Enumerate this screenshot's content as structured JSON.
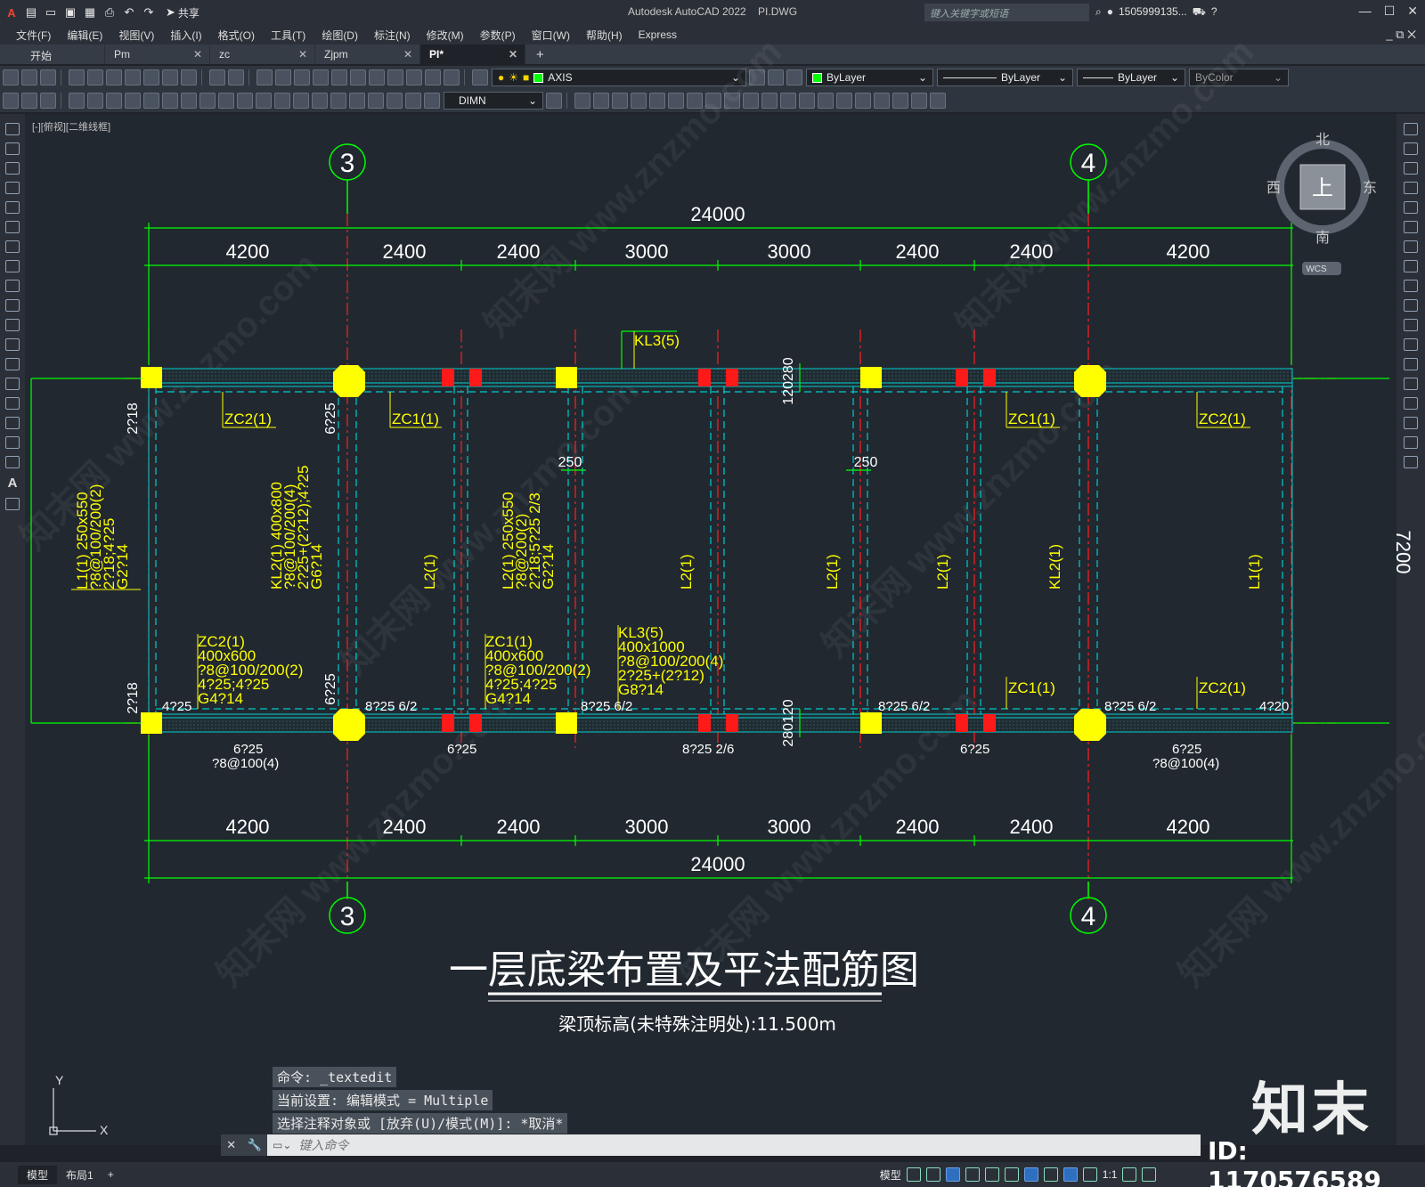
{
  "app": {
    "title": "Autodesk AutoCAD 2022",
    "filename": "PI.DWG",
    "search_placeholder": "键入关键字或短语",
    "user": "1505999135...",
    "share_label": "共享"
  },
  "menu": [
    "文件(F)",
    "编辑(E)",
    "视图(V)",
    "插入(I)",
    "格式(O)",
    "工具(T)",
    "绘图(D)",
    "标注(N)",
    "修改(M)",
    "参数(P)",
    "窗口(W)",
    "帮助(H)",
    "Express"
  ],
  "tabs": [
    "开始",
    "Pm",
    "zc",
    "Zjpm",
    "PI*"
  ],
  "toolbar": {
    "layer": "AXIS",
    "color": "ByLayer",
    "linetype": "ByLayer",
    "lineweight": "ByLayer",
    "plotstyle": "ByColor",
    "dimstyle": "DIMN"
  },
  "viewport": {
    "label": "[-][俯视][二维线框]",
    "viewcube": {
      "top": "上",
      "n": "北",
      "s": "南",
      "e": "东",
      "w": "西",
      "wcs": "WCS"
    }
  },
  "colors": {
    "axis": "#00ff00",
    "dim_text": "#ffffff",
    "beam_text": "#ffff00",
    "beam_line": "#00cccc",
    "column": "#ffff00",
    "axis_line": "#ff0000"
  },
  "drawing": {
    "axis_top_left": "3",
    "axis_top_right": "4",
    "axis_bottom_left": "3",
    "axis_bottom_right": "4",
    "total_top": "24000",
    "total_bottom": "24000",
    "spans_top": [
      "4200",
      "2400",
      "2400",
      "3000",
      "3000",
      "2400",
      "2400",
      "4200"
    ],
    "spans_bottom": [
      "4200",
      "2400",
      "2400",
      "3000",
      "3000",
      "2400",
      "2400",
      "4200"
    ],
    "right_dim": "7200",
    "labels": {
      "kl3_top": "KL3(5)",
      "zc2_tl": "ZC2(1)",
      "zc1_t1": "ZC1(1)",
      "zc1_t2": "ZC1(1)",
      "zc2_tr": "ZC2(1)",
      "zc1_b": "ZC1(1)",
      "zc2_br": "ZC2(1)",
      "d250a": "250",
      "d250b": "250",
      "d120_280": "120280",
      "d280_120": "280120",
      "d625a": "6?25",
      "d625b": "6?25",
      "d218a": "2?18",
      "d218b": "2?18",
      "l1_left": [
        "L1(1) 250x550",
        "?8@100/200(2)",
        "2?18;4?25",
        "G2?14"
      ],
      "kl2_mid": [
        "KL2(1) 400x800",
        "?8@100/200(4)",
        "2?25+(2?12);4?25",
        "G6?14"
      ],
      "l2_col": [
        "L2(1) 250x550",
        "?8@200(2)",
        "2?18;5?25 2/3",
        "G2?14"
      ],
      "l2a": "L2(1)",
      "l2b": "L2(1)",
      "l2c": "L2(1)",
      "l2d": "L2(1)",
      "kl2_r": "KL2(1)",
      "l1_r": "L1(1)",
      "zc2_block": [
        "ZC2(1)",
        "400x600",
        "?8@100/200(2)",
        "4?25;4?25",
        "G4?14"
      ],
      "zc1_block": [
        "ZC1(1)",
        "400x600",
        "?8@100/200(2)",
        "4?25;4?25",
        "G4?14"
      ],
      "kl3_block": [
        "KL3(5)",
        "400x1000",
        "?8@100/200(4)",
        "2?25+(2?12)",
        "G8?14"
      ],
      "b425": "4?25",
      "b825a": "8?25 6/2",
      "b825b": "8?25 6/2",
      "b825c": "8?25 6/2",
      "b825d": "8?25 6/2",
      "b420": "4?20",
      "bot_625a": "6?25",
      "bot_8100a": "?8@100(4)",
      "bot_625b": "6?25",
      "bot_825": "8?25 2/6",
      "bot_625c": "6?25",
      "bot_625d": "6?25",
      "bot_8100b": "?8@100(4)"
    },
    "title": "一层底梁布置及平法配筋图",
    "subtitle": "梁顶标高(未特殊注明处):11.500m"
  },
  "command": {
    "history": [
      "命令: _textedit",
      "当前设置: 编辑模式 = Multiple",
      "选择注释对象或 [放弃(U)/模式(M)]: *取消*"
    ],
    "placeholder": "键入命令"
  },
  "status": {
    "layout_tabs": [
      "模型",
      "布局1"
    ],
    "model_label": "模型",
    "scale": "1:1"
  },
  "watermark": {
    "logo": "知末",
    "id": "ID: 1170576589"
  }
}
